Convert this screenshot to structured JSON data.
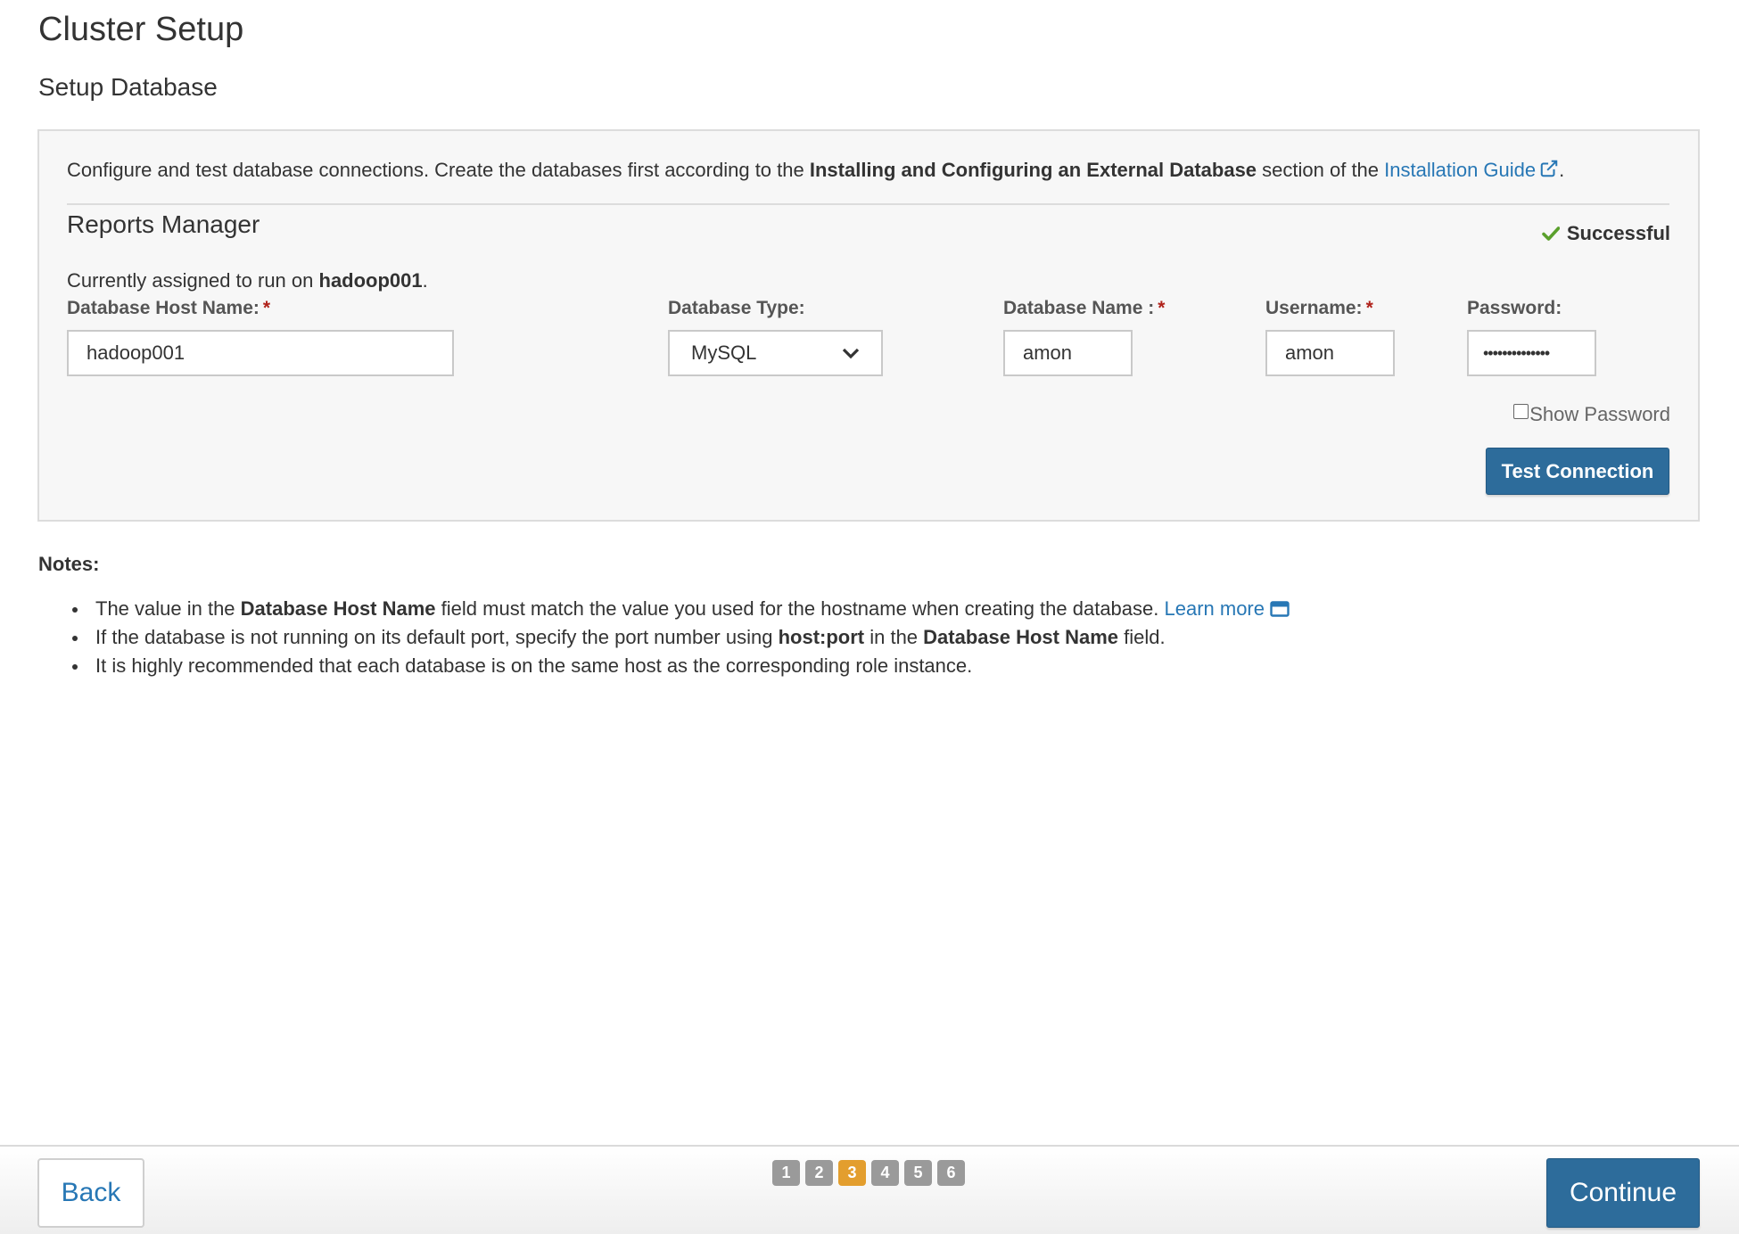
{
  "page": {
    "title": "Cluster Setup",
    "subtitle": "Setup Database"
  },
  "intro": {
    "text_before": "Configure and test database connections. Create the databases first according to the ",
    "bold": "Installing and Configuring an External Database",
    "text_middle": " section of the ",
    "link": "Installation Guide",
    "text_after": "."
  },
  "section": {
    "title": "Reports Manager",
    "status": "Successful",
    "assigned_prefix": "Currently assigned to run on ",
    "assigned_host": "hadoop001",
    "assigned_suffix": "."
  },
  "fields": {
    "host": {
      "label": "Database Host Name:",
      "required": "*",
      "value": "hadoop001"
    },
    "type": {
      "label": "Database Type:",
      "value": "MySQL"
    },
    "name": {
      "label": "Database Name :",
      "required": "*",
      "value": "amon"
    },
    "username": {
      "label": "Username:",
      "required": "*",
      "value": "amon"
    },
    "password": {
      "label": "Password:",
      "value": "••••••••••••••"
    }
  },
  "show_password_label": "Show Password",
  "test_button": "Test Connection",
  "notes": {
    "title": "Notes:",
    "items": [
      {
        "t1": "The value in the ",
        "b1": "Database Host Name",
        "t2": " field must match the value you used for the hostname when creating the database. ",
        "link": "Learn more"
      },
      {
        "t1": "If the database is not running on its default port, specify the port number using ",
        "b1": "host:port",
        "t2": " in the ",
        "b2": "Database Host Name",
        "t3": " field."
      },
      {
        "t1": "It is highly recommended that each database is on the same host as the corresponding role instance."
      }
    ]
  },
  "footer": {
    "back": "Back",
    "continue": "Continue",
    "steps": [
      "1",
      "2",
      "3",
      "4",
      "5",
      "6"
    ],
    "active_step": "3"
  },
  "colors": {
    "primary_button": "#2d6c9b",
    "link": "#2777b5",
    "active_step": "#e39e2e",
    "inactive_step": "#9a9a9a",
    "success_check": "#5aa02c",
    "required": "#b0221b"
  }
}
